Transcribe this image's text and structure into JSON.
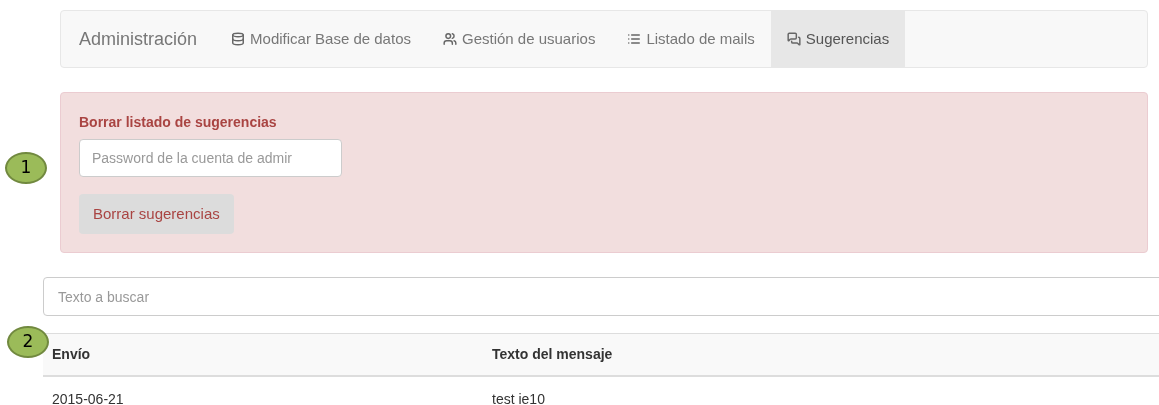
{
  "navbar": {
    "brand": "Administración",
    "items": [
      {
        "label": "Modificar Base de datos",
        "selected": false
      },
      {
        "label": "Gestión de usuarios",
        "selected": false
      },
      {
        "label": "Listado de mails",
        "selected": false
      },
      {
        "label": "Sugerencias",
        "selected": true
      }
    ]
  },
  "alert": {
    "title": "Borrar listado de sugerencias",
    "password_field": {
      "placeholder": "Password de la cuenta de admir"
    },
    "button": "Borrar sugerencias"
  },
  "search": {
    "placeholder": "Texto a buscar"
  },
  "table": {
    "columns": [
      "Envío",
      "Texto del mensaje"
    ],
    "rows": [
      [
        "2015-06-21",
        "test ie10"
      ]
    ]
  },
  "callouts": [
    "1",
    "2"
  ]
}
